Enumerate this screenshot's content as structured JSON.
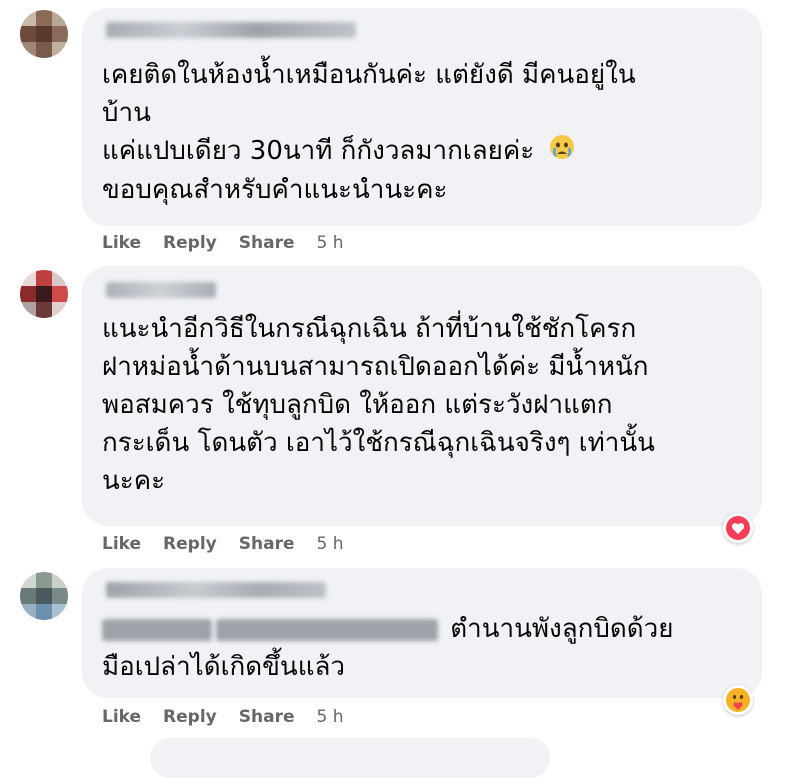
{
  "comments": [
    {
      "lines": [
        "เคยติดในห้องน้ำเหมือนกันค่ะ แต่ยังดี มีคนอยู่ใน",
        "บ้าน",
        "แค่แปบเดียว 30นาที ก็กังวลมากเลยค่ะ",
        "ขอบคุณสำหรับคำแนะนำนะคะ"
      ],
      "emoji_icon": "crying-face-icon",
      "actions": {
        "like": "Like",
        "reply": "Reply",
        "share": "Share",
        "time": "5 h"
      }
    },
    {
      "lines": [
        "แนะนำอีกวิธีในกรณีฉุกเฉิน ถ้าที่บ้านใช้ชักโครก",
        "ฝาหม่อน้ำด้านบนสามารถเปิดออกได้ค่ะ มีน้ำหนัก",
        "พอสมควร ใช้ทุบลูกบิด ให้ออก แต่ระวังฝาแตก",
        "กระเด็น โดนตัว เอาไว้ใช้กรณีฉุกเฉินจริงๆ เท่านั้น",
        "นะคะ"
      ],
      "reaction_icon": "heart-reaction-icon",
      "actions": {
        "like": "Like",
        "reply": "Reply",
        "share": "Share",
        "time": "5 h"
      }
    },
    {
      "lines": [
        "ตำนานพังลูกบิดด้วย",
        "มือเปล่าได้เกิดขึ้นแล้ว"
      ],
      "reaction_icon": "care-reaction-icon",
      "actions": {
        "like": "Like",
        "reply": "Reply",
        "share": "Share",
        "time": "5 h"
      }
    }
  ],
  "colors": {
    "bubble": "#f0f2f5",
    "text": "#050505",
    "meta": "#65676b",
    "heart": "#f33e58",
    "care": "#f7b125"
  }
}
